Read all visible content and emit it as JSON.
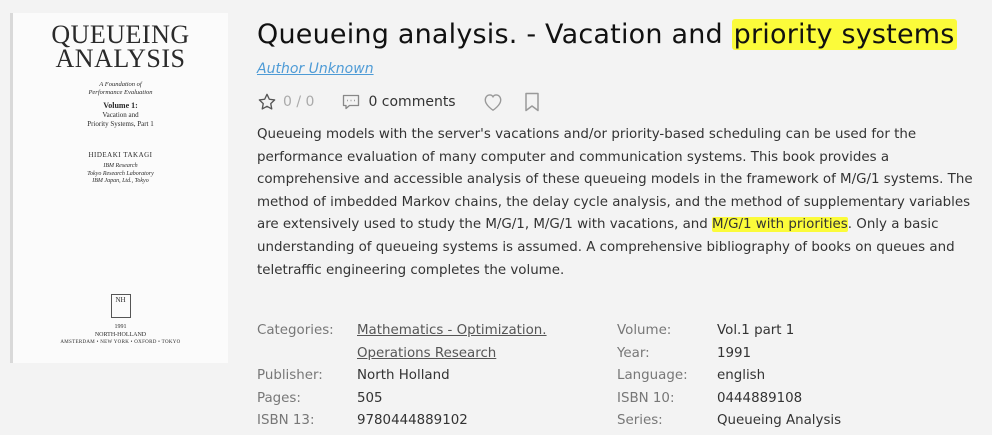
{
  "cover": {
    "title_line1": "QUEUEING",
    "title_line2": "ANALYSIS",
    "subtitle_line1": "A Foundation of",
    "subtitle_line2": "Performance Evaluation",
    "volume": "Volume 1:",
    "volume_line1": "Vacation and",
    "volume_line2": "Priority Systems, Part 1",
    "author": "HIDEAKI TAKAGI",
    "aff1": "IBM Research",
    "aff2": "Tokyo Research Laboratory",
    "aff3": "IBM Japan, Ltd., Tokyo",
    "logo": "NH",
    "year": "1991",
    "publisher": "NORTH-HOLLAND",
    "cities": "AMSTERDAM • NEW YORK • OXFORD • TOKYO"
  },
  "book": {
    "title_plain": "Queueing analysis. - Vacation and ",
    "title_highlight": "priority systems",
    "author": "Author Unknown",
    "rating": "0 / 0",
    "comments": "0 comments",
    "description_part1": "Queueing models with the server's vacations and/or priority-based scheduling can be used for the performance evaluation of many computer and communication systems. This book provides a comprehensive and accessible analysis of these queueing models in the framework of M/G/1 systems. The method of imbedded Markov chains, the delay cycle analysis, and the method of supplementary variables are extensively used to study the M/G/1, M/G/1 with vacations, and ",
    "description_highlight": "M/G/1 with priorities",
    "description_part2": ". Only a basic understanding of queueing systems is assumed. A comprehensive bibliography of books on queues and teletraffic engineering completes the volume."
  },
  "meta_left": {
    "categories_label": "Categories:",
    "category1": "Mathematics - Optimization.",
    "category2": "Operations Research",
    "publisher_label": "Publisher:",
    "publisher": "North Holland",
    "pages_label": "Pages:",
    "pages": "505",
    "isbn13_label": "ISBN 13:",
    "isbn13": "9780444889102"
  },
  "meta_right": {
    "volume_label": "Volume:",
    "volume": "Vol.1 part 1",
    "year_label": "Year:",
    "year": "1991",
    "language_label": "Language:",
    "language": "english",
    "isbn10_label": "ISBN 10:",
    "isbn10": "0444889108",
    "series_label": "Series:",
    "series": "Queueing Analysis"
  },
  "colors": {
    "highlight": "#fbfb3a",
    "link": "#4e9bd6",
    "background": "#f3f3f3"
  },
  "icons": [
    "star-icon",
    "comment-icon",
    "heart-icon",
    "bookmark-icon"
  ]
}
